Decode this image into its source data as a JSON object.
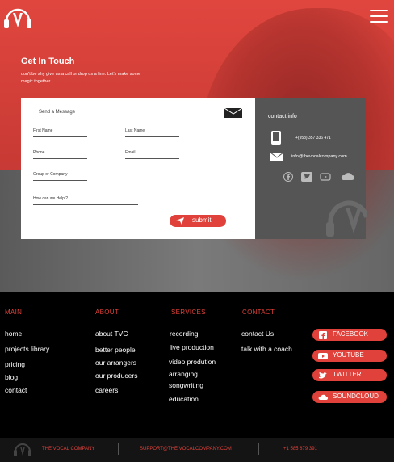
{
  "hero": {
    "title": "Get In Touch",
    "subtitle": "don't be shy give us a call or drop us a line. Let's make some magic together."
  },
  "form": {
    "send_label": "Send a Message",
    "first_name": "First Name",
    "last_name": "Last Name",
    "phone": "Phone",
    "email": "Email",
    "group": "Group or Company",
    "help": "How can we Help ?",
    "submit": "submit"
  },
  "contact": {
    "title": "contact info",
    "phone": "+(958) 357 336 471",
    "email": "info@thevocalcompany.com"
  },
  "footer": {
    "main": {
      "head": "MAIN",
      "links": [
        "home",
        "projects library",
        "pricing",
        "blog",
        "contact"
      ]
    },
    "about": {
      "head": "ABOUT",
      "links": [
        "about TVC",
        "better people",
        "our arrangers",
        "our producers",
        "careers"
      ]
    },
    "services": {
      "head": "SERVICES",
      "links": [
        "recording",
        "live production",
        "video prodution",
        "arranging",
        "songwriting",
        "education"
      ]
    },
    "contact": {
      "head": "CONTACT",
      "links": [
        "contact Us",
        "talk with a coach"
      ]
    },
    "social": [
      "FACEBOOK",
      "YOUTUBE",
      "TWITTER",
      "SOUNDCLOUD"
    ]
  },
  "bottom": {
    "company": "THE VOCAL COMPANY",
    "support": "SUPPORT@THE VOCALCOMPANY.COM",
    "phone": "+1 585 879 391"
  },
  "colors": {
    "accent": "#e0413a",
    "dark": "#555555"
  }
}
